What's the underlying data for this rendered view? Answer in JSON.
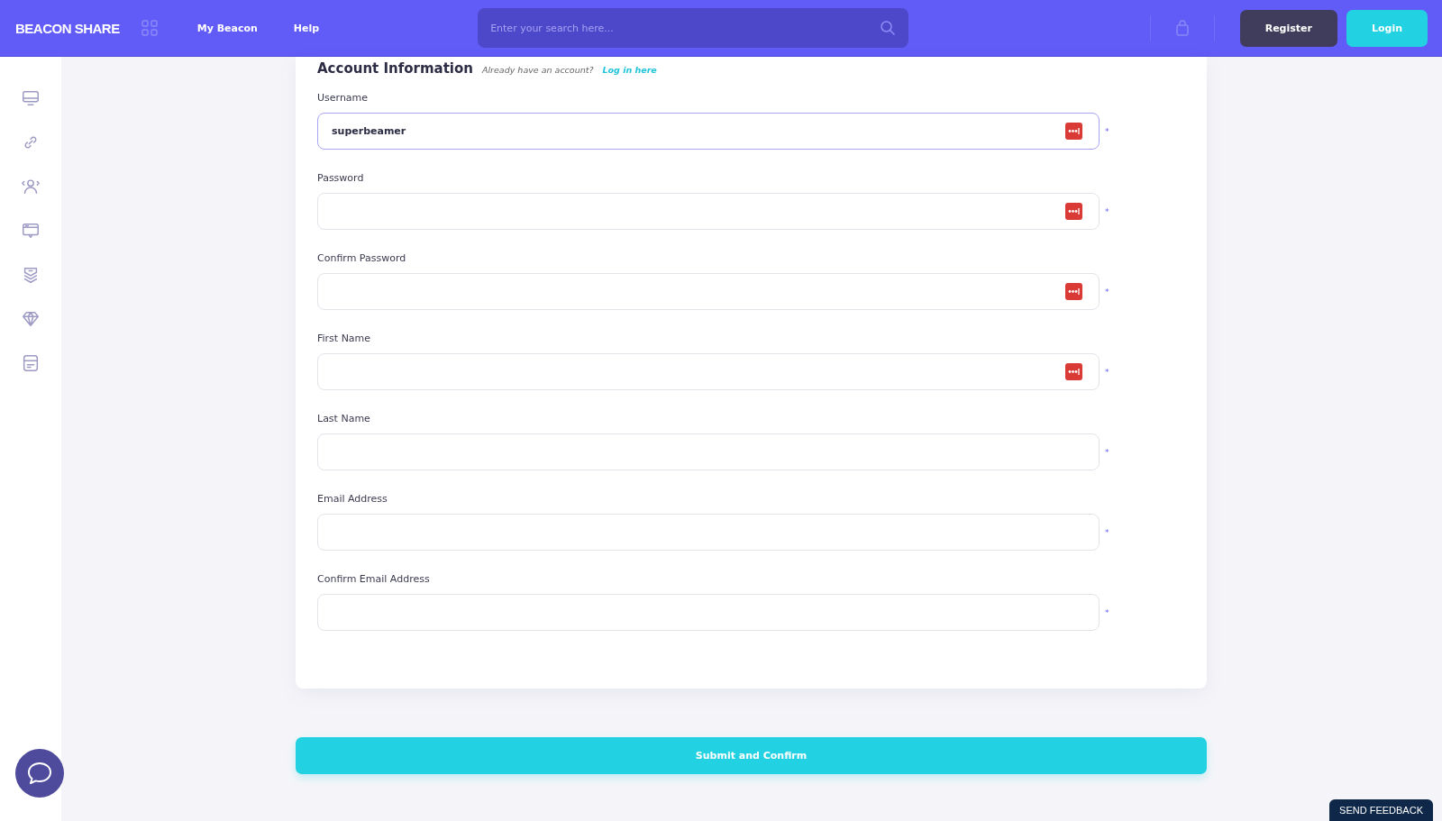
{
  "header": {
    "logo": "BEACON SHARE",
    "nav": [
      {
        "label": "My Beacon"
      },
      {
        "label": "Help"
      }
    ],
    "search": {
      "placeholder": "Enter your search here..."
    },
    "buttons": [
      {
        "label": "Register",
        "kind": "dark"
      },
      {
        "label": "Login",
        "kind": "accent"
      }
    ]
  },
  "form": {
    "title": "Account Information",
    "hint": "Already have an account?",
    "link": "Log in here",
    "fields": [
      {
        "label": "Username",
        "value": "superbeamer",
        "focused": true,
        "autofill_icon": true,
        "mark": "*"
      },
      {
        "label": "Password",
        "focused": false,
        "autofill_icon": true,
        "mark": "*"
      },
      {
        "label": "Confirm Password",
        "focused": false,
        "autofill_icon": true,
        "mark": "*"
      },
      {
        "label": "First Name",
        "focused": false,
        "autofill_icon": true,
        "mark": "*"
      },
      {
        "label": "Last Name",
        "focused": false,
        "autofill_icon": false,
        "mark": "*"
      },
      {
        "label": "Email Address",
        "focused": false,
        "autofill_icon": false,
        "mark": "*"
      },
      {
        "label": "Confirm Email Address",
        "focused": false,
        "autofill_icon": false,
        "mark": "*"
      }
    ]
  },
  "submit": "Submit and Confirm",
  "feedback": "SEND FEEDBACK"
}
